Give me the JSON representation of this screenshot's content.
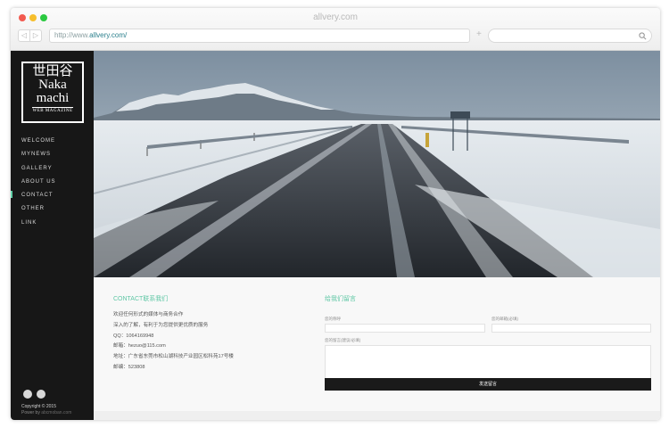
{
  "browser": {
    "window_title": "allvery.com",
    "url_prefix": "http://www.",
    "url_domain": "allvery.com/",
    "back_glyph": "◁",
    "forward_glyph": "▷",
    "new_tab_glyph": "+",
    "traffic_lights": [
      "#f25a4f",
      "#f6be2c",
      "#2bc940"
    ]
  },
  "sidebar": {
    "logo": {
      "line1": "世田谷",
      "line2": "Naka",
      "line3": "machi",
      "subtitle": "WEB MAGAZINE"
    },
    "menu": [
      {
        "label": "WELCOME"
      },
      {
        "label": "MYNEWS"
      },
      {
        "label": "GALLERY"
      },
      {
        "label": "ABOUT US"
      },
      {
        "label": "CONTACT"
      },
      {
        "label": "OTHER"
      },
      {
        "label": "LINK"
      }
    ],
    "active_item": "CONTACT",
    "social_icons": [
      "wechat-icon",
      "weibo-icon"
    ],
    "copyright": "Copyright © 2015",
    "powered_prefix": "Power by ",
    "powered_name": "abcmoban.com"
  },
  "hero": {
    "subject": "snowy road through mountains"
  },
  "contact": {
    "title": "CONTACT联系我们",
    "lines": [
      "欢迎任何形式的媒体与商务合作",
      "深入的了解，有利于为您提供更优质的服务",
      "QQ：1064169948",
      "邮箱：hezuo@115.com",
      "地址：广东省东莞市松山湖科技产业园区松科苑17号楼",
      "邮编：523808"
    ]
  },
  "message_form": {
    "title": "给我们留言",
    "name_label": "您的称呼",
    "email_label": "您的邮箱(必填)",
    "message_label": "您的留言(建议/必填)",
    "submit_label": "发送留言"
  },
  "colors": {
    "accent": "#5fc7a5",
    "sidebar_bg": "#171717",
    "button_bg": "#1a1a1a"
  }
}
